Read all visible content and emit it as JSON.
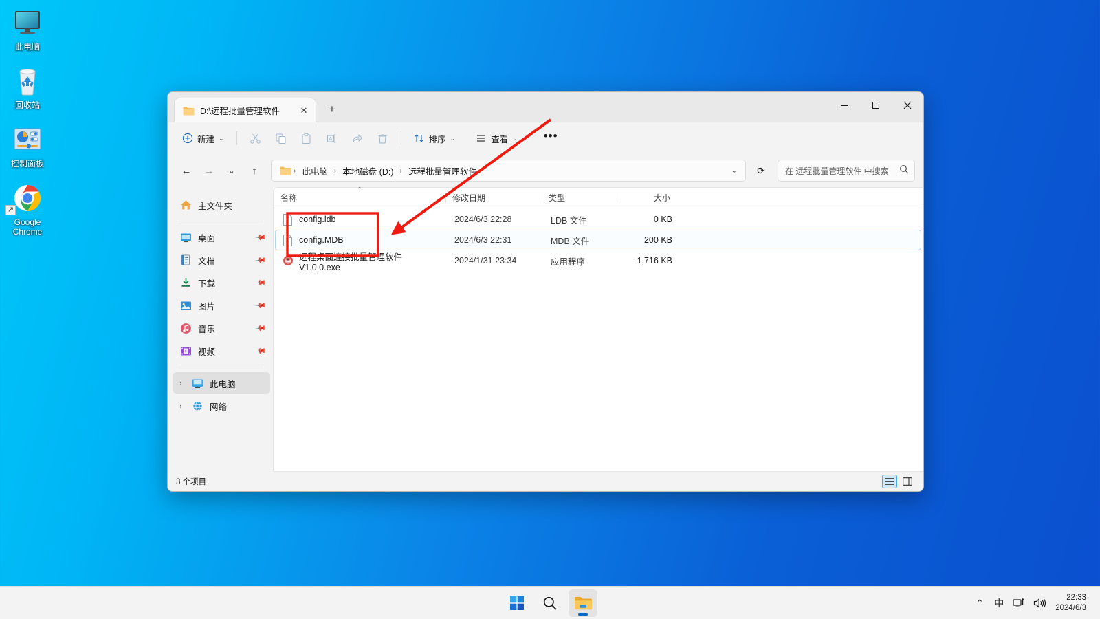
{
  "desktop": {
    "icons": [
      {
        "label": "此电脑",
        "icon": "this-pc-icon",
        "shortcut": false
      },
      {
        "label": "回收站",
        "icon": "recycle-bin-icon",
        "shortcut": false
      },
      {
        "label": "控制面板",
        "icon": "control-panel-icon",
        "shortcut": false
      },
      {
        "label": "Google Chrome",
        "icon": "google-chrome-icon",
        "shortcut": true
      }
    ],
    "background_colors": {
      "left": "#00c8fa",
      "right": "#0a4fcf"
    }
  },
  "explorer": {
    "tab": {
      "title": "D:\\远程批量管理软件",
      "close_label": "✕",
      "new_tab_label": "+"
    },
    "window_controls": {
      "minimize": "minimize-button",
      "maximize": "maximize-button",
      "close": "close-button"
    },
    "toolbar": {
      "new_label": "新建",
      "cut_label": "剪切",
      "copy_label": "复制",
      "paste_label": "粘贴",
      "rename_label": "重命名",
      "share_label": "共享",
      "delete_label": "删除",
      "sort_label": "排序",
      "view_label": "查看",
      "more_label": "•••"
    },
    "address": {
      "back": "←",
      "forward": "→",
      "recent": "⌄",
      "up": "↑",
      "crumbs": [
        "此电脑",
        "本地磁盘 (D:)",
        "远程批量管理软件"
      ],
      "separator": "›",
      "dropdown_caret": "⌄",
      "refresh": "⟳"
    },
    "search": {
      "placeholder": "在 远程批量管理软件 中搜索",
      "icon": "search-icon"
    },
    "sidebar": {
      "home": {
        "label": "主文件夹",
        "icon": "home-icon"
      },
      "quick_access": [
        {
          "label": "桌面",
          "icon": "desktop-icon",
          "pinned": true
        },
        {
          "label": "文档",
          "icon": "documents-icon",
          "pinned": true
        },
        {
          "label": "下载",
          "icon": "downloads-icon",
          "pinned": true
        },
        {
          "label": "图片",
          "icon": "pictures-icon",
          "pinned": true
        },
        {
          "label": "音乐",
          "icon": "music-icon",
          "pinned": true
        },
        {
          "label": "视频",
          "icon": "videos-icon",
          "pinned": true
        }
      ],
      "trees": [
        {
          "label": "此电脑",
          "icon": "this-pc-icon",
          "selected": true,
          "twisty": "›"
        },
        {
          "label": "网络",
          "icon": "network-icon",
          "selected": false,
          "twisty": "›"
        }
      ]
    },
    "columns": {
      "name": "名称",
      "date": "修改日期",
      "type": "类型",
      "size": "大小",
      "sort_indicator": "⌃"
    },
    "files": [
      {
        "name": "config.ldb",
        "date": "2024/6/3 22:28",
        "type": "LDB 文件",
        "size": "0 KB",
        "icon": "generic-file-icon",
        "selected": false
      },
      {
        "name": "config.MDB",
        "date": "2024/6/3 22:31",
        "type": "MDB 文件",
        "size": "200 KB",
        "icon": "generic-file-icon",
        "selected": true
      },
      {
        "name": "远程桌面连接批量管理软件 V1.0.0.exe",
        "date": "2024/1/31 23:34",
        "type": "应用程序",
        "size": "1,716 KB",
        "icon": "application-icon",
        "selected": false
      }
    ],
    "status": {
      "item_count": "3 个项目",
      "details_view": "details-view-button",
      "pane_view": "pane-view-button"
    }
  },
  "annotation": {
    "color": "#ee1b11",
    "arrow_name": "red-annotation-arrow",
    "box_name": "red-highlight-box"
  },
  "taskbar": {
    "items": [
      {
        "name": "start-button",
        "icon": "windows-logo-icon",
        "active": false
      },
      {
        "name": "search-button",
        "icon": "search-icon",
        "active": false
      },
      {
        "name": "file-explorer-button",
        "icon": "folder-icon",
        "active": true
      }
    ],
    "tray": {
      "overflow": "⌃",
      "ime": "中",
      "network": "network-icon",
      "volume": "volume-icon",
      "time": "22:33",
      "date": "2024/6/3"
    }
  }
}
